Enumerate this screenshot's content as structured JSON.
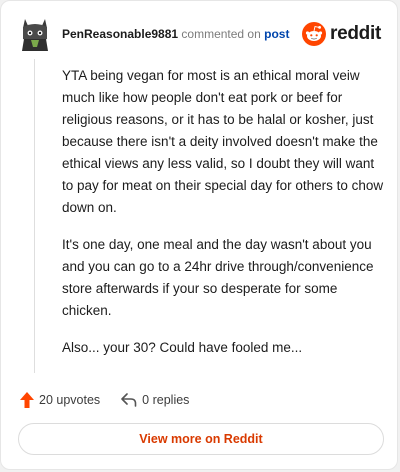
{
  "comment": {
    "username": "PenReasonable9881",
    "action_text": "commented on",
    "post_link": "post",
    "body": [
      "YTA being vegan for most is an ethical moral veiw much like how people don't eat pork or beef for religious reasons, or it has to be halal or kosher, just because there isn't a deity involved doesn't make the ethical views any less valid, so I doubt they will want to pay for meat on their special day for others to chow down on.",
      "It's one day, one meal and the day wasn't about you and you can go to a 24hr drive through/convenience store afterwards if your so desperate for some chicken.",
      "Also... your 30? Could have fooled me..."
    ]
  },
  "brand": {
    "name": "reddit",
    "accent": "#ff4500"
  },
  "actions": {
    "upvotes": "20 upvotes",
    "replies": "0 replies"
  },
  "footer": {
    "view_more": "View more on Reddit"
  },
  "icons": {
    "avatar": "avatar-icon",
    "logo": "reddit-snoo-icon",
    "upvote": "upvote-arrow-icon",
    "reply": "reply-arrow-icon"
  }
}
